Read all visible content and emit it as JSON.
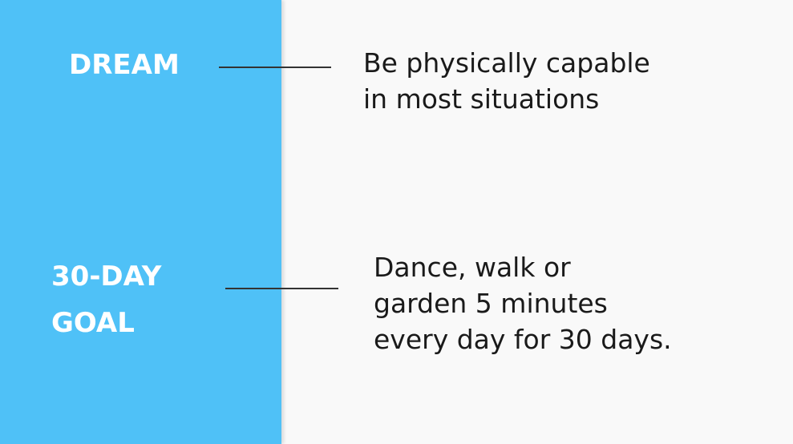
{
  "slide": {
    "dream": {
      "label": "DREAM",
      "text_lines": [
        "Be physically capable",
        "in most situations"
      ]
    },
    "goal": {
      "label_lines": [
        "30-DAY",
        "GOAL"
      ],
      "text_lines": [
        "Dance, walk or",
        "garden 5 minutes",
        "every day for 30 days."
      ]
    }
  },
  "colors": {
    "left_panel": "#4fc1f7",
    "background": "#f9f9f9",
    "label_text": "#ffffff",
    "body_text": "#1a1a1a",
    "connector": "#333333"
  }
}
